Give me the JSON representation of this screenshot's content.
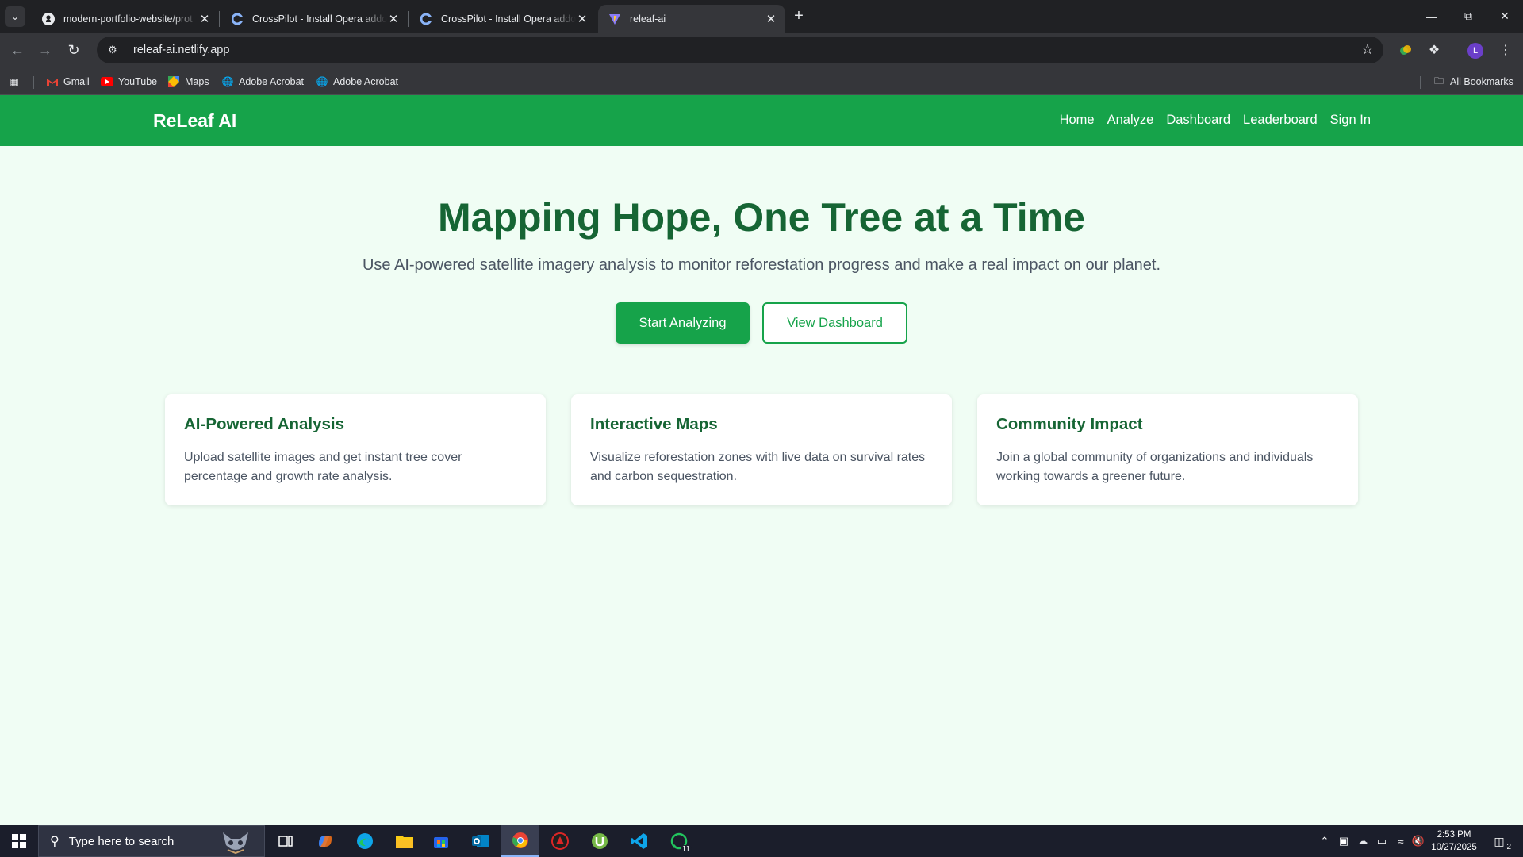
{
  "browser": {
    "tabs": [
      {
        "title": "modern-portfolio-website/prot",
        "icon": "github-icon"
      },
      {
        "title": "CrossPilot - Install Opera addon",
        "icon": "crosspilot-icon"
      },
      {
        "title": "CrossPilot - Install Opera addon",
        "icon": "crosspilot-icon"
      },
      {
        "title": "releaf-ai",
        "icon": "vite-icon",
        "active": true
      }
    ],
    "url": "releaf-ai.netlify.app",
    "bookmarks": [
      {
        "label": "Gmail",
        "icon": "gmail-icon"
      },
      {
        "label": "YouTube",
        "icon": "youtube-icon"
      },
      {
        "label": "Maps",
        "icon": "maps-icon"
      },
      {
        "label": "Adobe Acrobat",
        "icon": "globe-icon"
      },
      {
        "label": "Adobe Acrobat",
        "icon": "globe-icon"
      }
    ],
    "all_bookmarks": "All Bookmarks",
    "profile_initial": "L"
  },
  "site": {
    "brand": "ReLeaf AI",
    "nav": [
      "Home",
      "Analyze",
      "Dashboard",
      "Leaderboard",
      "Sign In"
    ],
    "hero": {
      "title": "Mapping Hope, One Tree at a Time",
      "subtitle": "Use AI-powered satellite imagery analysis to monitor reforestation progress and make a real impact on our planet.",
      "primary_button": "Start Analyzing",
      "secondary_button": "View Dashboard"
    },
    "features": [
      {
        "title": "AI-Powered Analysis",
        "text": "Upload satellite images and get instant tree cover percentage and growth rate analysis."
      },
      {
        "title": "Interactive Maps",
        "text": "Visualize reforestation zones with live data on survival rates and carbon sequestration."
      },
      {
        "title": "Community Impact",
        "text": "Join a global community of organizations and individuals working towards a greener future."
      }
    ],
    "colors": {
      "primary": "#16a34a",
      "heading": "#166534",
      "background": "#f0fdf4"
    }
  },
  "taskbar": {
    "search_placeholder": "Type here to search",
    "time": "2:53 PM",
    "date": "10/27/2025",
    "whatsapp_badge": "11",
    "notification_count": "2"
  }
}
